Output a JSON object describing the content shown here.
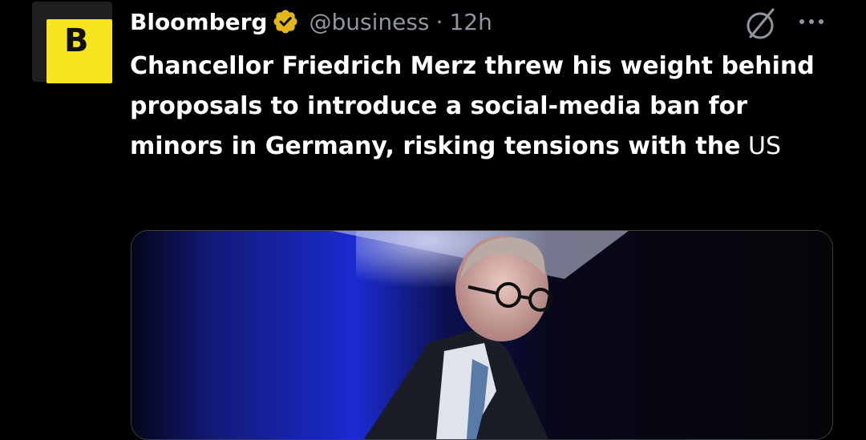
{
  "account": {
    "display_name": "Bloomberg",
    "handle": "@business",
    "separator": "·",
    "time": "12h",
    "avatar_letter": "B",
    "avatar_color": "#f7e51d",
    "verified_icon": "verified-business-badge-icon",
    "verified_color": "#e2b719"
  },
  "actions": {
    "grok_icon": "grok-icon",
    "more_icon": "more-options-icon"
  },
  "tweet": {
    "text_bold": "Chancellor Friedrich Merz threw his weight behind proposals to introduce a social-media ban for minors in Germany, risking tensions with the",
    "text_tail": " US"
  },
  "media": {
    "description_icon": "photo-icon"
  }
}
